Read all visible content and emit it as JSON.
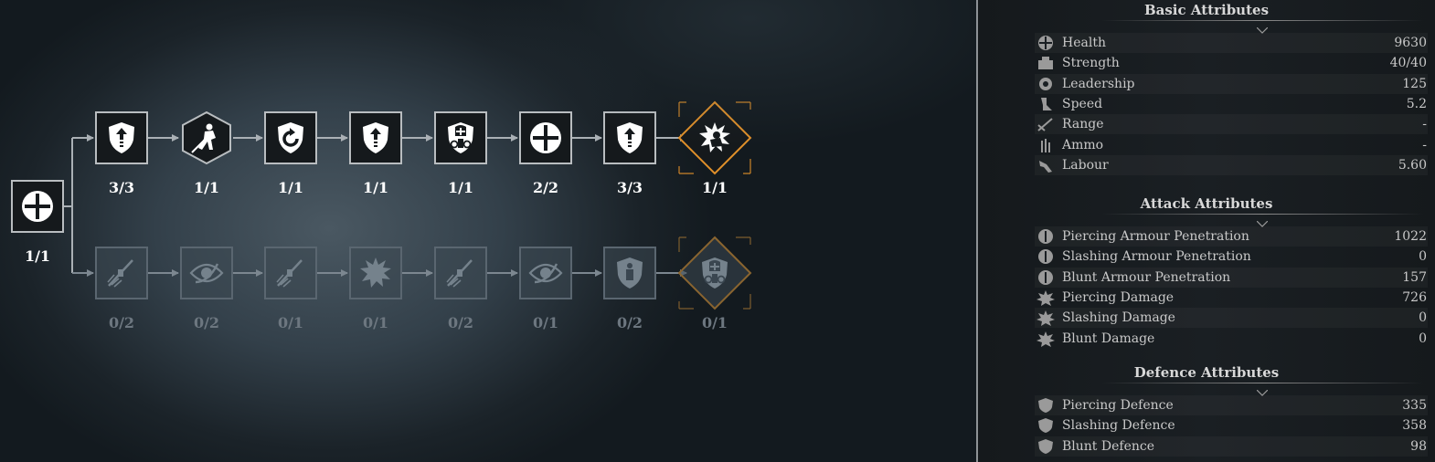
{
  "tree": {
    "root": {
      "label": "1/1",
      "icon": "health-cross-icon"
    },
    "top": [
      {
        "label": "3/3",
        "icon": "shield-arrow-icon"
      },
      {
        "label": "1/1",
        "icon": "warrior-lunge-icon"
      },
      {
        "label": "1/1",
        "icon": "shield-cycle-icon"
      },
      {
        "label": "1/1",
        "icon": "shield-arrow-icon"
      },
      {
        "label": "1/1",
        "icon": "knight-armor-icon"
      },
      {
        "label": "2/2",
        "icon": "health-cross-icon"
      },
      {
        "label": "3/3",
        "icon": "shield-arrow-icon"
      },
      {
        "label": "1/1",
        "icon": "burst-knight-icon"
      }
    ],
    "bottom": [
      {
        "label": "0/2",
        "icon": "sword-strike-icon"
      },
      {
        "label": "0/2",
        "icon": "eye-slash-icon"
      },
      {
        "label": "0/1",
        "icon": "sword-strike-icon"
      },
      {
        "label": "0/1",
        "icon": "burst-icon"
      },
      {
        "label": "0/2",
        "icon": "sword-strike-icon"
      },
      {
        "label": "0/1",
        "icon": "eye-slash-icon"
      },
      {
        "label": "0/2",
        "icon": "shield-figure-icon"
      },
      {
        "label": "0/1",
        "icon": "knight-armor-icon"
      }
    ]
  },
  "attributes": {
    "basic": {
      "title": "Basic Attributes",
      "rows": [
        {
          "name": "Health",
          "value": "9630",
          "icon": "health-icon"
        },
        {
          "name": "Strength",
          "value": "40/40",
          "icon": "strength-icon"
        },
        {
          "name": "Leadership",
          "value": "125",
          "icon": "leadership-icon"
        },
        {
          "name": "Speed",
          "value": "5.2",
          "icon": "speed-icon"
        },
        {
          "name": "Range",
          "value": "-",
          "icon": "range-icon"
        },
        {
          "name": "Ammo",
          "value": "-",
          "icon": "ammo-icon"
        },
        {
          "name": "Labour",
          "value": "5.60",
          "icon": "labour-icon"
        }
      ]
    },
    "attack": {
      "title": "Attack Attributes",
      "rows": [
        {
          "name": "Piercing Armour Penetration",
          "value": "1022",
          "icon": "piercing-penetration-icon"
        },
        {
          "name": "Slashing Armour Penetration",
          "value": "0",
          "icon": "slashing-penetration-icon"
        },
        {
          "name": "Blunt Armour Penetration",
          "value": "157",
          "icon": "blunt-penetration-icon"
        },
        {
          "name": "Piercing Damage",
          "value": "726",
          "icon": "piercing-damage-icon"
        },
        {
          "name": "Slashing Damage",
          "value": "0",
          "icon": "slashing-damage-icon"
        },
        {
          "name": "Blunt Damage",
          "value": "0",
          "icon": "blunt-damage-icon"
        }
      ]
    },
    "defence": {
      "title": "Defence Attributes",
      "rows": [
        {
          "name": "Piercing Defence",
          "value": "335",
          "icon": "piercing-defence-icon"
        },
        {
          "name": "Slashing Defence",
          "value": "358",
          "icon": "slashing-defence-icon"
        },
        {
          "name": "Blunt Defence",
          "value": "98",
          "icon": "blunt-defence-icon"
        }
      ]
    }
  },
  "colors": {
    "accent": "#e0902a",
    "active_border": "#b9bdc0",
    "locked_text": "#6d7780"
  }
}
